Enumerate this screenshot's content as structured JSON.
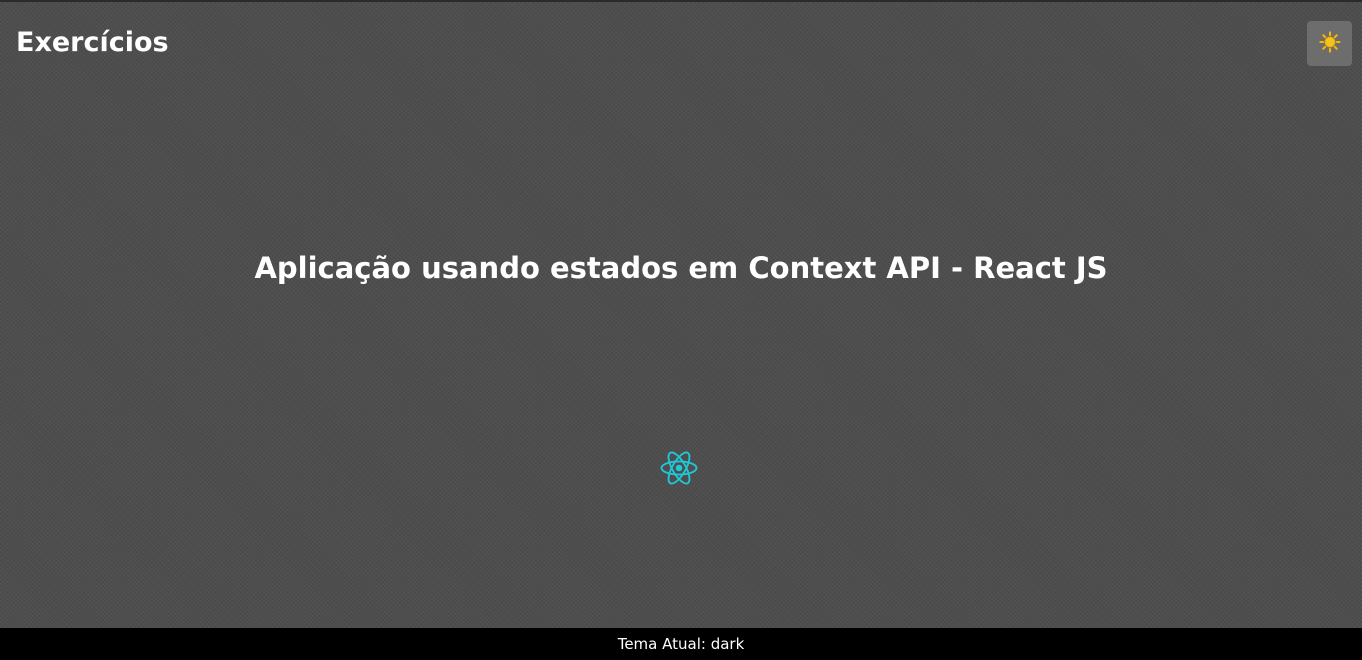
{
  "header": {
    "title": "Exercícios",
    "theme_toggle_icon": "sun-icon"
  },
  "main": {
    "heading": "Aplicação usando estados em Context API - React JS",
    "logo_icon": "react-logo-icon"
  },
  "footer": {
    "label": "Tema Atual:",
    "theme_value": "dark"
  },
  "colors": {
    "background": "#4d4d4d",
    "footer_background": "#000000",
    "toggle_background": "#6d6d6d",
    "react_cyan": "#20c7d6",
    "sun_yellow": "#f5b800"
  }
}
